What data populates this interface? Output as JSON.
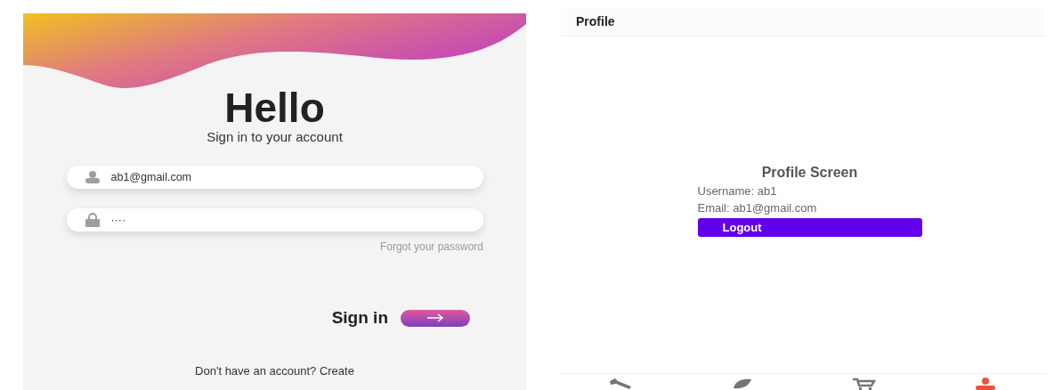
{
  "login": {
    "title": "Hello",
    "subtitle": "Sign in to your account",
    "fields": [
      {
        "kind": "user",
        "value": "ab1@gmail.com"
      },
      {
        "kind": "lock",
        "value": "····"
      }
    ],
    "forgot_link": "Forgot your password",
    "sign_in_label": "Sign in",
    "signup_prompt": "Don't have an account? Create"
  },
  "profile": {
    "app_bar_title": "Profile",
    "heading": "Profile Screen",
    "username_line": "Username: ab1",
    "email_line": "Email: ab1@gmail.com",
    "logout_button": "Logout",
    "tabs": [
      {
        "kind": "wrench",
        "selected": false
      },
      {
        "kind": "leaf",
        "selected": false
      },
      {
        "kind": "cart",
        "selected": false
      },
      {
        "kind": "person",
        "selected": true
      }
    ]
  }
}
